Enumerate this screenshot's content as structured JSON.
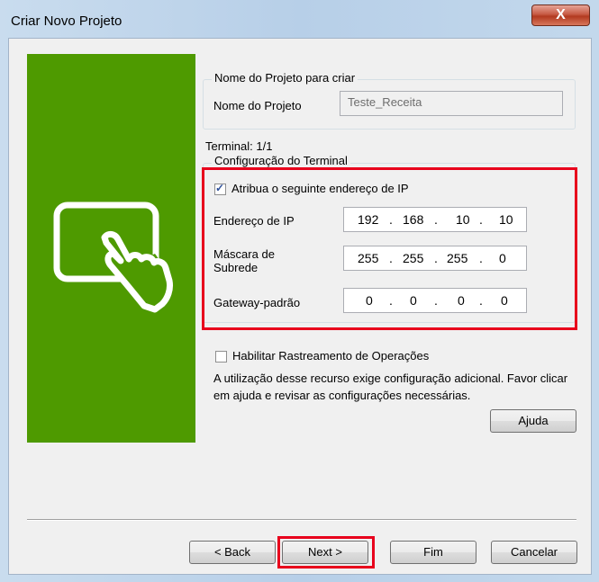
{
  "window": {
    "title": "Criar Novo Projeto",
    "close_label": "X"
  },
  "project_group": {
    "legend": "Nome do Projeto para criar",
    "name_label": "Nome do Projeto",
    "name_value": "Teste_Receita"
  },
  "terminal": {
    "count_label": "Terminal: 1/1",
    "config_legend": "Configuração do Terminal",
    "assign_ip_label": "Atribua o seguinte endereço de IP",
    "assign_ip_checked": true,
    "ip_label": "Endereço de IP",
    "ip": [
      "192",
      "168",
      "10",
      "10"
    ],
    "mask_label": "Máscara de Subrede",
    "mask": [
      "255",
      "255",
      "255",
      "0"
    ],
    "gateway_label": "Gateway-padrão",
    "gateway": [
      "0",
      "0",
      "0",
      "0"
    ]
  },
  "tracking": {
    "checkbox_label": "Habilitar Rastreamento de Operações",
    "checked": false,
    "note": "A utilização desse recurso exige configuração adicional. Favor clicar em ajuda e revisar as configurações necessárias.",
    "help_label": "Ajuda"
  },
  "footer": {
    "back_label": "< Back",
    "next_label": "Next >",
    "finish_label": "Fim",
    "cancel_label": "Cancelar"
  },
  "colors": {
    "green_panel": "#4e9a00",
    "highlight": "#e8001c"
  },
  "icons": {
    "illustration": "touch-screen-hand-icon"
  }
}
